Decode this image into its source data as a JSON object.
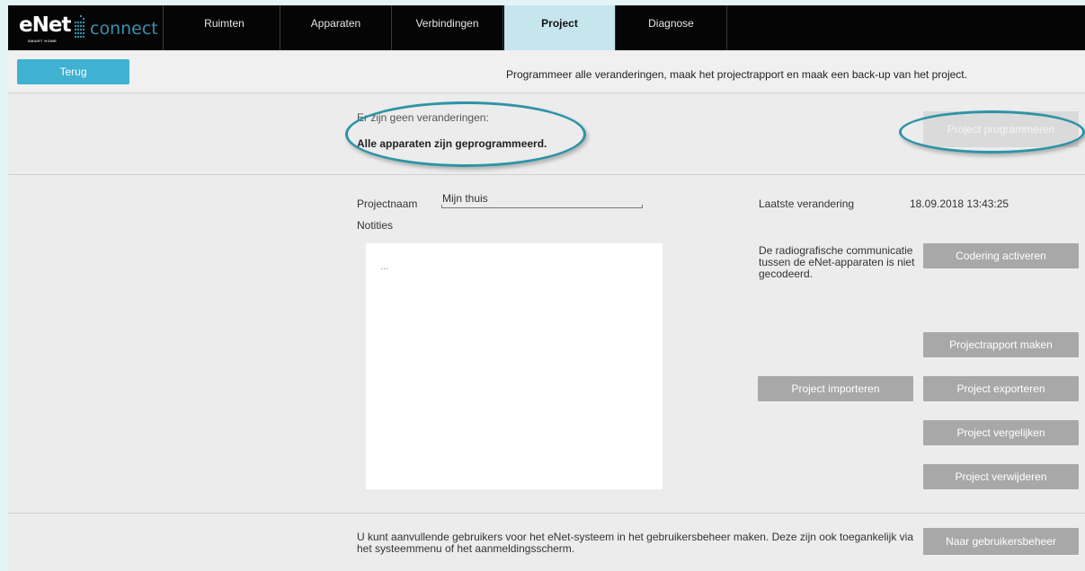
{
  "brand": {
    "logo_text": "eNet",
    "logo_sub": "SMART HOME",
    "product": "connect"
  },
  "tabs": [
    {
      "label": "Ruimten"
    },
    {
      "label": "Apparaten"
    },
    {
      "label": "Verbindingen"
    },
    {
      "label": "Project",
      "active": true
    },
    {
      "label": "Diagnose"
    }
  ],
  "subbar": {
    "back_label": "Terug",
    "description": "Programmeer alle veranderingen, maak het projectrapport en maak een back-up van het project."
  },
  "status": {
    "line1": "Er zijn geen veranderingen:",
    "line2": "Alle apparaten zijn geprogrammeerd.",
    "program_button": "Project programmeren"
  },
  "project": {
    "name_label": "Projectnaam",
    "name_value": "Mijn thuis",
    "notes_label": "Notities",
    "notes_value": "...",
    "last_change_label": "Laatste verandering",
    "last_change_value": "18.09.2018 13:43:25",
    "encryption_text": "De radiografische communicatie tussen de eNet-apparaten is niet gecodeerd."
  },
  "actions": {
    "encrypt": "Codering activeren",
    "report": "Projectrapport maken",
    "import": "Project importeren",
    "export": "Project exporteren",
    "compare": "Project vergelijken",
    "delete": "Project verwijderen"
  },
  "users": {
    "text": "U kunt aanvullende gebruikers voor het eNet-systeem in het gebruikersbeheer maken. Deze zijn ook toegankelijk via het systeemmenu of het aanmeldingsscherm.",
    "button": "Naar gebruikersbeheer"
  },
  "colors": {
    "accent": "#3fb1d1",
    "active_tab": "#c6e6ee",
    "highlight_ring": "#2d93a6",
    "button_gray": "#a8a8a8"
  }
}
